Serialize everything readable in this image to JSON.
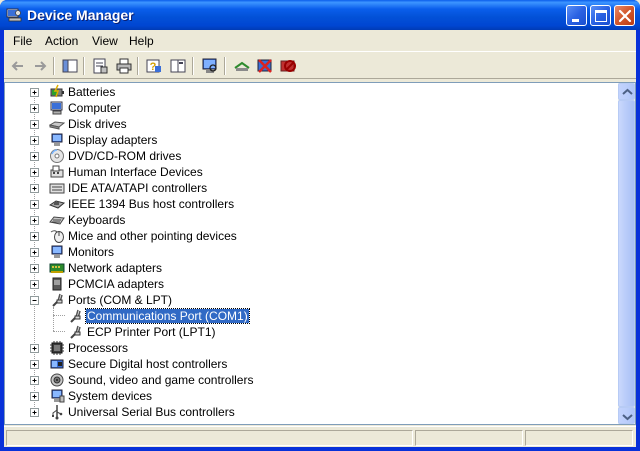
{
  "window": {
    "title": "Device Manager"
  },
  "menu": [
    "File",
    "Action",
    "View",
    "Help"
  ],
  "toolbar": {
    "icons": [
      "back-arrow-icon",
      "forward-arrow-icon",
      "show-hide-tree-icon",
      "properties-icon",
      "print-icon",
      "help-icon",
      "view-pane-icon",
      "scan-hardware-icon",
      "update-driver-icon",
      "uninstall-icon",
      "disable-icon"
    ]
  },
  "tree": {
    "items": [
      {
        "label": "Batteries",
        "icon": "battery-icon"
      },
      {
        "label": "Computer",
        "icon": "computer-icon"
      },
      {
        "label": "Disk drives",
        "icon": "disk-drive-icon"
      },
      {
        "label": "Display adapters",
        "icon": "display-adapter-icon"
      },
      {
        "label": "DVD/CD-ROM drives",
        "icon": "cd-drive-icon"
      },
      {
        "label": "Human Interface Devices",
        "icon": "hid-icon"
      },
      {
        "label": "IDE ATA/ATAPI controllers",
        "icon": "ide-controller-icon"
      },
      {
        "label": "IEEE 1394 Bus host controllers",
        "icon": "ieee1394-icon"
      },
      {
        "label": "Keyboards",
        "icon": "keyboard-icon"
      },
      {
        "label": "Mice and other pointing devices",
        "icon": "mouse-icon"
      },
      {
        "label": "Monitors",
        "icon": "monitor-icon"
      },
      {
        "label": "Network adapters",
        "icon": "network-adapter-icon"
      },
      {
        "label": "PCMCIA adapters",
        "icon": "pcmcia-icon"
      },
      {
        "label": "Ports (COM & LPT)",
        "icon": "port-icon",
        "expanded": true,
        "children": [
          {
            "label": "Communications Port (COM1)",
            "icon": "port-icon",
            "selected": true
          },
          {
            "label": "ECP Printer Port (LPT1)",
            "icon": "port-icon"
          }
        ]
      },
      {
        "label": "Processors",
        "icon": "processor-icon"
      },
      {
        "label": "Secure Digital host controllers",
        "icon": "sd-controller-icon"
      },
      {
        "label": "Sound, video and game controllers",
        "icon": "sound-icon"
      },
      {
        "label": "System devices",
        "icon": "system-device-icon"
      },
      {
        "label": "Universal Serial Bus controllers",
        "icon": "usb-icon"
      }
    ]
  },
  "colors": {
    "titlebar": "#0A5EEB",
    "selection": "#316AC5",
    "face": "#ECE9D8"
  }
}
